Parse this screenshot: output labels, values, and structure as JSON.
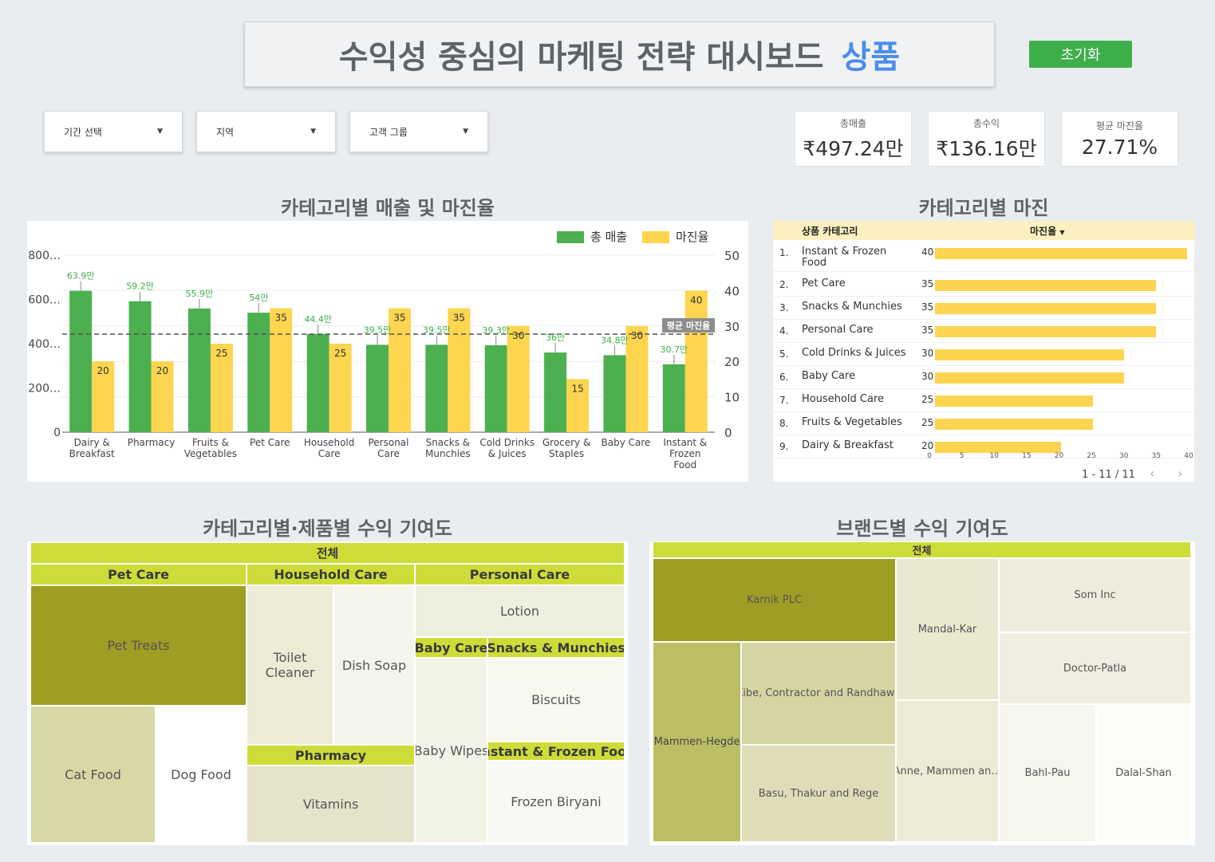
{
  "header": {
    "title": "수익성 중심의 마케팅 전략 대시보드",
    "accent": "상품",
    "reset_label": "초기화"
  },
  "filters": [
    {
      "label": "기간 선택"
    },
    {
      "label": "지역"
    },
    {
      "label": "고객 그룹"
    }
  ],
  "kpis": [
    {
      "label": "총매출",
      "value": "₹497.24만"
    },
    {
      "label": "총수익",
      "value": "₹136.16만"
    },
    {
      "label": "평균 마진율",
      "value": "27.71%"
    }
  ],
  "combo": {
    "title": "카테고리별 매출 및 마진율",
    "legend": [
      "총 매출",
      "마진율"
    ],
    "avg_label": "평균 마진율",
    "colors": {
      "revenue": "#4caf50",
      "margin": "#fdd54f",
      "revenue_label": "#3eae4a"
    }
  },
  "chart_data": {
    "type": "bar",
    "categories": [
      "Dairy & Breakfast",
      "Pharmacy",
      "Fruits & Vegetables",
      "Pet Care",
      "Household Care",
      "Personal Care",
      "Snacks & Munchies",
      "Cold Drinks & Juices",
      "Grocery & Staples",
      "Baby Care",
      "Instant & Frozen Food"
    ],
    "category_lines": [
      [
        "Dairy &",
        "Breakfast"
      ],
      [
        "Pharmacy"
      ],
      [
        "Fruits &",
        "Vegetables"
      ],
      [
        "Pet Care"
      ],
      [
        "Household",
        "Care"
      ],
      [
        "Personal",
        "Care"
      ],
      [
        "Snacks &",
        "Munchies"
      ],
      [
        "Cold Drinks",
        "& Juices"
      ],
      [
        "Grocery &",
        "Staples"
      ],
      [
        "Baby Care"
      ],
      [
        "Instant &",
        "Frozen",
        "Food"
      ]
    ],
    "series": [
      {
        "name": "총 매출",
        "axis": "left",
        "values": [
          63.9,
          59.2,
          55.9,
          54,
          44.4,
          39.5,
          39.5,
          39.3,
          36,
          34.8,
          30.7
        ],
        "labels": [
          "63.9만",
          "59.2만",
          "55.9만",
          "54만",
          "44.4만",
          "39.5만",
          "39.5만",
          "39.3만",
          "36만",
          "34.8만",
          "30.7만"
        ]
      },
      {
        "name": "마진율",
        "axis": "right",
        "values": [
          20,
          20,
          25,
          35,
          25,
          35,
          35,
          30,
          15,
          30,
          40
        ]
      }
    ],
    "left_ticks": [
      "0",
      "200…",
      "400…",
      "600…",
      "800…"
    ],
    "ylim_left": [
      0,
      80
    ],
    "right_ticks": [
      "0",
      "10",
      "20",
      "30",
      "40",
      "50"
    ],
    "ylim_right": [
      0,
      50
    ],
    "average_margin": 27.71,
    "legend_position": "top-right"
  },
  "margin_table": {
    "title": "카테고리별 마진",
    "col_category": "상품 카테고리",
    "col_margin": "마진율",
    "sort_icon": "▼",
    "rows": [
      {
        "idx": "1.",
        "category": "Instant & Frozen Food",
        "margin": 40
      },
      {
        "idx": "2.",
        "category": "Pet Care",
        "margin": 35
      },
      {
        "idx": "3.",
        "category": "Snacks & Munchies",
        "margin": 35
      },
      {
        "idx": "4.",
        "category": "Personal Care",
        "margin": 35
      },
      {
        "idx": "5.",
        "category": "Cold Drinks & Juices",
        "margin": 30
      },
      {
        "idx": "6.",
        "category": "Baby Care",
        "margin": 30
      },
      {
        "idx": "7.",
        "category": "Household Care",
        "margin": 25
      },
      {
        "idx": "8.",
        "category": "Fruits & Vegetables",
        "margin": 25
      },
      {
        "idx": "9.",
        "category": "Dairy & Breakfast",
        "margin": 20
      }
    ],
    "axis_ticks": [
      "0",
      "5",
      "10",
      "15",
      "20",
      "25",
      "30",
      "35",
      "40"
    ],
    "axis_max": 40,
    "pagination": "1 - 11 / 11",
    "prev_icon": "‹",
    "next_icon": "›"
  },
  "treemap_category": {
    "title": "카테고리별·제품별 수익 기여도",
    "root": "전체",
    "groups": {
      "pet_care": "Pet Care",
      "household_care": "Household Care",
      "personal_care": "Personal Care",
      "baby_care": "Baby Care",
      "snacks": "Snacks & Munchies",
      "pharmacy": "Pharmacy",
      "instant": "Instant & Frozen Food"
    },
    "items": {
      "pet_treats": "Pet Treats",
      "cat_food": "Cat Food",
      "dog_food": "Dog Food",
      "toilet_cleaner": "Toilet Cleaner",
      "dish_soap": "Dish Soap",
      "vitamins": "Vitamins",
      "lotion": "Lotion",
      "baby_wipes": "Baby Wipes",
      "biscuits": "Biscuits",
      "frozen_biryani": "Frozen Biryani"
    }
  },
  "treemap_brand": {
    "title": "브랜드별 수익 기여도",
    "root": "전체",
    "items": {
      "karnik": "Karnik PLC",
      "mandal": "Mandal-Kar",
      "som": "Som Inc",
      "doctor": "Doctor-Patla",
      "mammen": "Mammen-Hegde",
      "kibe": "Kibe, Contractor and Randhawa",
      "basu": "Basu, Thakur and Rege",
      "anne": "Anne, Mammen an…",
      "bahl": "Bahl-Pau",
      "dalal": "Dalal-Shan"
    }
  }
}
